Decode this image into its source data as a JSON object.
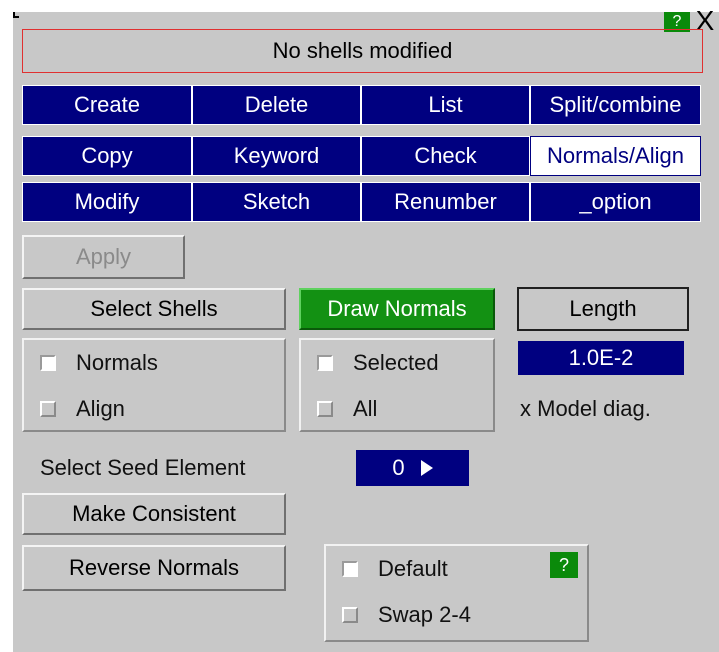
{
  "window": {
    "help_label": "?",
    "close_label": "X"
  },
  "status": {
    "text": "No shells modified"
  },
  "nav": {
    "row1": [
      "Create",
      "Delete",
      "List",
      "Split/combine"
    ],
    "row2": [
      "Copy",
      "Keyword",
      "Check",
      "Normals/Align"
    ],
    "row3": [
      "Modify",
      "Sketch",
      "Renumber",
      "_option"
    ],
    "active": "Normals/Align"
  },
  "actions": {
    "apply": "Apply",
    "select_shells": "Select Shells",
    "draw_normals": "Draw Normals",
    "length": "Length"
  },
  "mode_group": {
    "normals": "Normals",
    "align": "Align"
  },
  "draw_group": {
    "selected": "Selected",
    "all": "All"
  },
  "length_value": "1.0E-2",
  "length_unit": "x Model diag.",
  "seed": {
    "label": "Select Seed Element",
    "value": "0"
  },
  "make_consistent": "Make Consistent",
  "reverse_normals": "Reverse Normals",
  "reverse_group": {
    "default": "Default",
    "swap": "Swap 2-4",
    "help": "?"
  },
  "colors": {
    "nav_bg": "#000080",
    "accent_green": "#139113",
    "panel_bg": "#c8c8c8"
  }
}
